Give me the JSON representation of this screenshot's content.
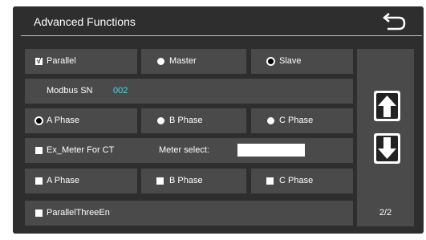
{
  "header": {
    "title": "Advanced Functions",
    "back_icon": "return-arrow-icon"
  },
  "row1": {
    "parallel_label": "Parallel",
    "parallel_checked": true,
    "master_label": "Master",
    "slave_label": "Slave",
    "selected": "Slave"
  },
  "row2": {
    "modbus_label": "Modbus SN",
    "modbus_value": "002"
  },
  "row3": {
    "a_label": "A Phase",
    "b_label": "B Phase",
    "c_label": "C Phase",
    "selected": "A Phase"
  },
  "row4": {
    "ex_meter_label": "Ex_Meter For CT",
    "meter_select_label": "Meter select:",
    "meter_select_value": ""
  },
  "row5": {
    "a_label": "A Phase",
    "b_label": "B Phase",
    "c_label": "C Phase"
  },
  "row6": {
    "parallel_three_label": "ParallelThreeEn"
  },
  "side": {
    "up_icon": "arrow-up-icon",
    "down_icon": "arrow-down-icon",
    "page_indicator": "2/2"
  },
  "colors": {
    "background": "#2e2e2e",
    "cell": "#4a4a4a",
    "modbus_value": "#55d4e8"
  }
}
